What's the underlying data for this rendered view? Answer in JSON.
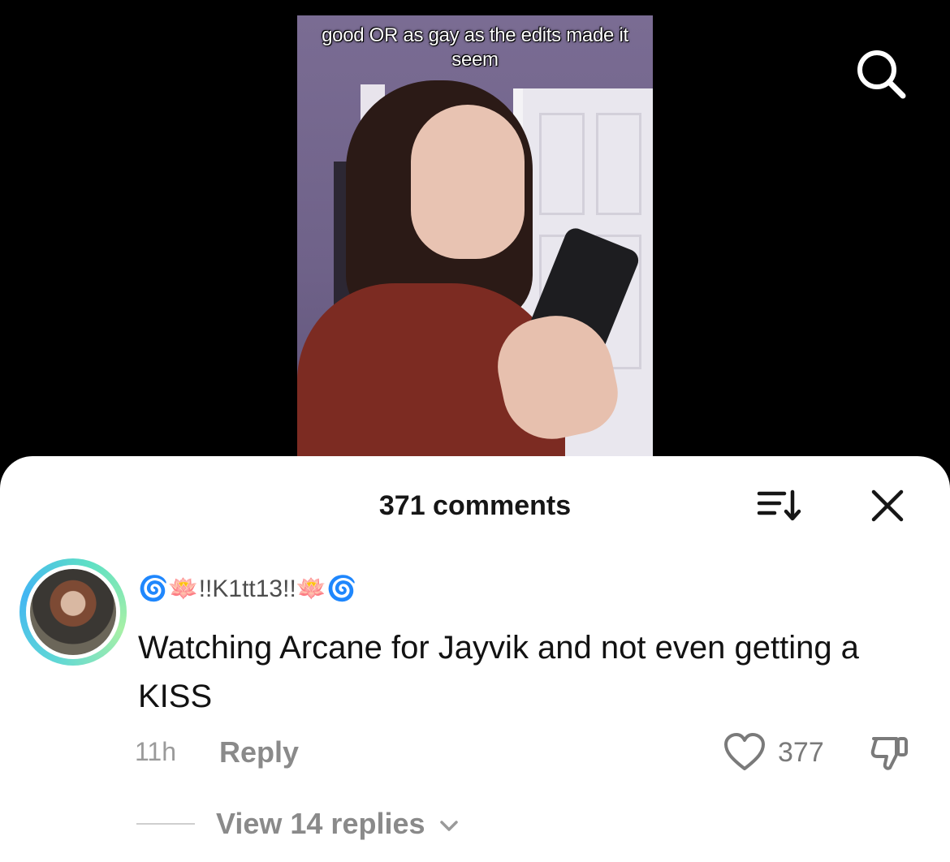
{
  "video": {
    "caption": "good OR as gay as the edits made it seem"
  },
  "comments_panel": {
    "count_label": "371 comments"
  },
  "comment": {
    "username": "🌀🪷!!K1tt13!!🪷🌀",
    "text": "Watching Arcane for Jayvik and not even getting a KISS",
    "time": "11h",
    "reply_label": "Reply",
    "like_count": "377",
    "view_replies_label": "View 14 replies"
  },
  "icons": {
    "search": "search-icon",
    "sort": "sort-icon",
    "close": "close-icon",
    "like": "heart-icon",
    "dislike": "thumbs-down-icon",
    "chevron": "chevron-down-icon"
  },
  "colors": {
    "sheet_background": "#ffffff",
    "video_background": "#000000",
    "avatar_ring": "#5fd7d6"
  }
}
